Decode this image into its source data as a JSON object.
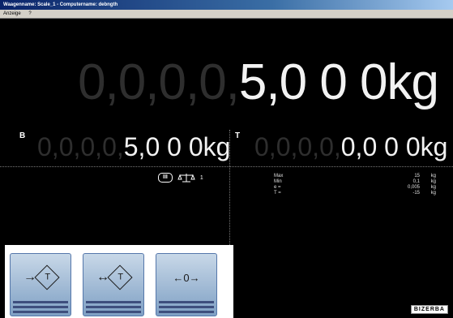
{
  "window": {
    "title": "Waagenname: Scale_1 - Computername: debngth"
  },
  "menu": {
    "items": [
      "Anzeige",
      "?"
    ]
  },
  "main": {
    "ghost_digits": "0,0,0,0,",
    "value": "5,0 0 0",
    "unit": "kg"
  },
  "brutto": {
    "letter": "B",
    "ghost_digits": "0,0,0,0,",
    "value": "5,0 0 0",
    "unit": "kg"
  },
  "tara": {
    "letter": "T",
    "ghost_digits": "0,0,0,0,",
    "value": "0,0 0 0",
    "unit": "kg"
  },
  "accuracy": {
    "class": "III",
    "range_icon": "scale-range-icon",
    "range_number": "1"
  },
  "metrology": [
    {
      "label": "Max",
      "value": "15",
      "unit": "kg"
    },
    {
      "label": "Min",
      "value": "0,1",
      "unit": "kg"
    },
    {
      "label": "e =",
      "value": "0,005",
      "unit": "kg"
    },
    {
      "label": "T =",
      "value": "-15",
      "unit": "kg"
    }
  ],
  "keys": [
    {
      "name": "tare-button",
      "prefix": "→",
      "symbol": "T",
      "suffix": ""
    },
    {
      "name": "clear-tare-button",
      "prefix": "↔",
      "symbol": "T",
      "suffix": ""
    },
    {
      "name": "zero-button",
      "prefix": "",
      "symbol": "←0→",
      "suffix": ""
    }
  ],
  "brand": {
    "logo": "BIZERBA"
  },
  "colors": {
    "background": "#000000",
    "active_digit": "#f2f2f2",
    "ghost_digit": "#2e2e2e",
    "key_blue": "#7fa0c4"
  }
}
